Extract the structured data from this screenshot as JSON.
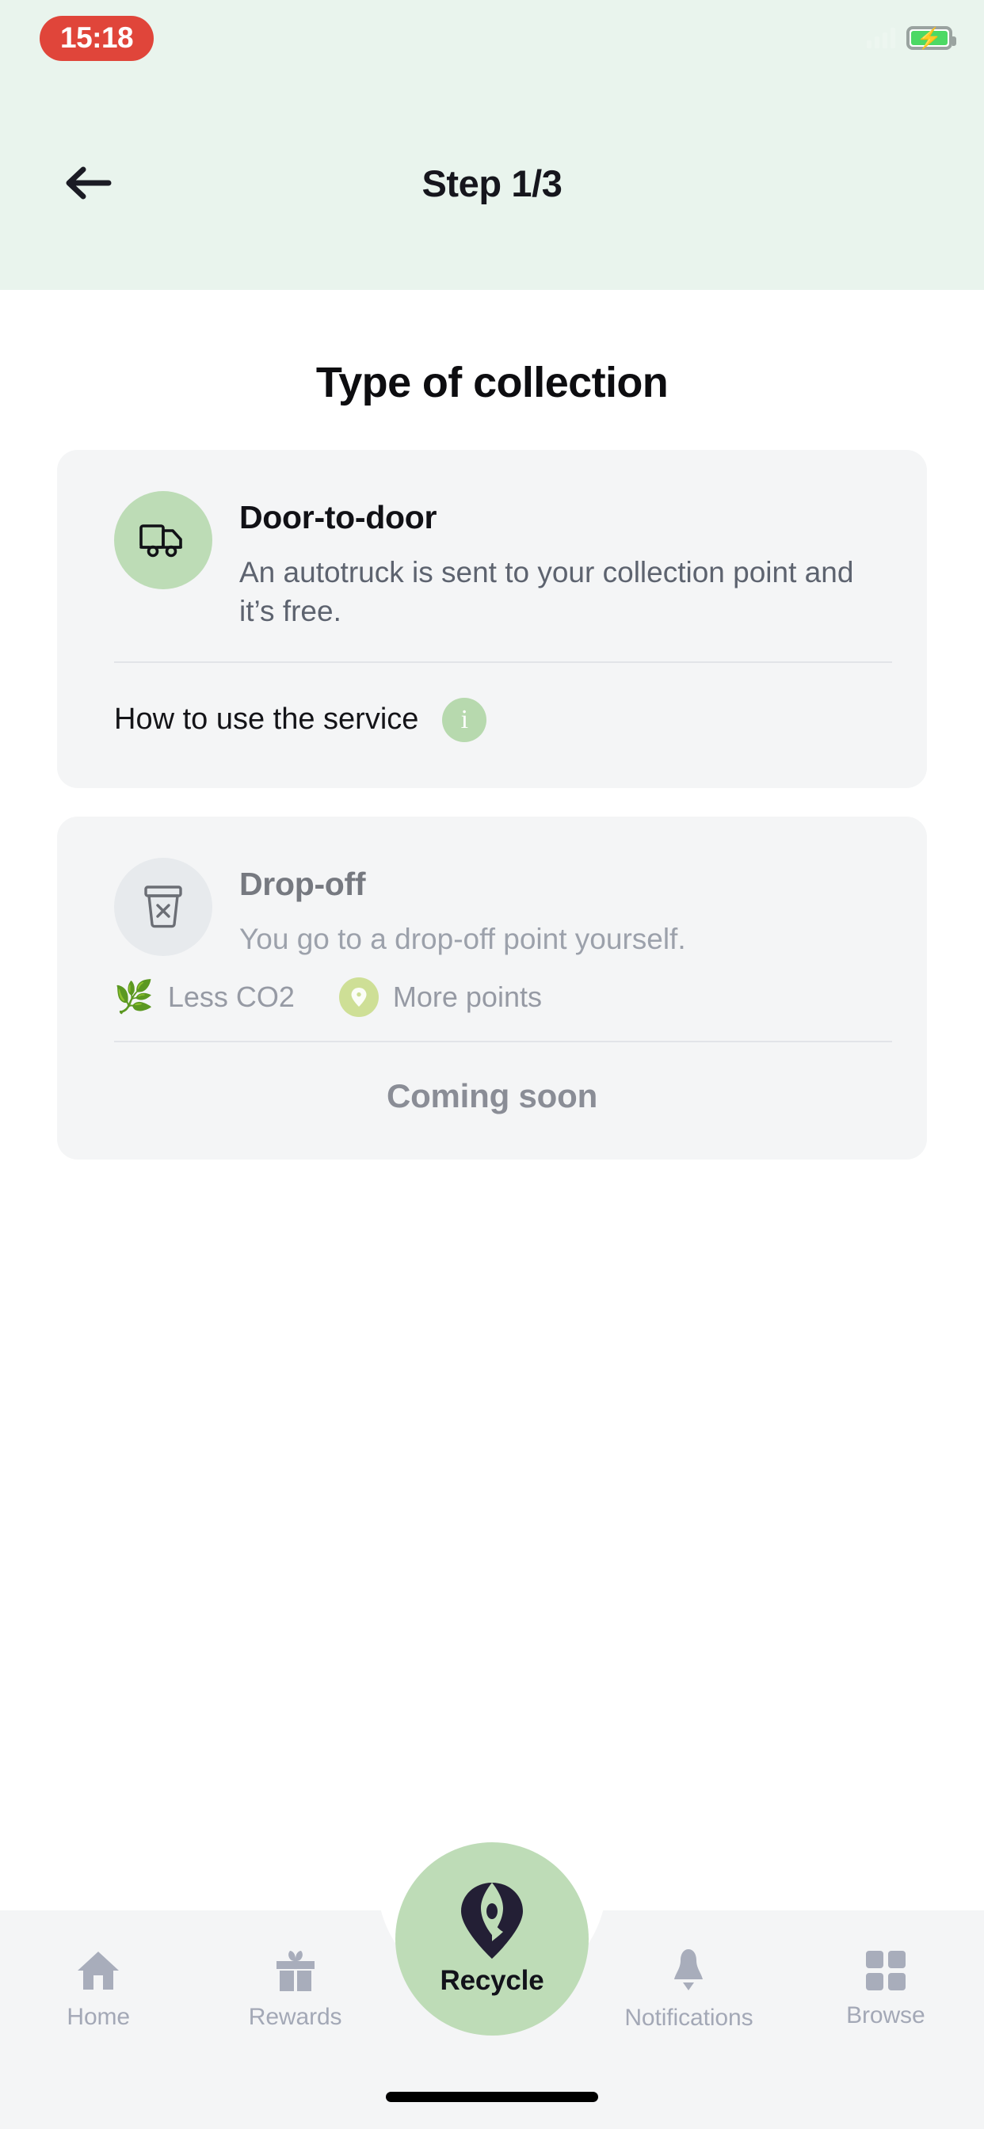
{
  "status_bar": {
    "recording_time": "15:18",
    "recording_pill_color": "#e0453a",
    "battery_icon": "battery-charging-icon",
    "battery_color": "#4cd964",
    "signal_icon": "signal-bars-icon"
  },
  "header": {
    "back_icon": "arrow-left-icon",
    "title": "Step 1/3",
    "background_color": "#e9f4ed"
  },
  "main": {
    "page_title": "Type of collection",
    "options": [
      {
        "id": "door-to-door",
        "icon": "truck-icon",
        "icon_bg_color": "#bddcb6",
        "title": "Door-to-door",
        "description": "An autotruck is sent to your collection point and it’s free.",
        "enabled": true,
        "footer_label": "How to use the service",
        "footer_icon": "info-icon",
        "footer_icon_bg_color": "#b7d9ae"
      },
      {
        "id": "drop-off",
        "icon": "bin-x-icon",
        "icon_bg_color": "#e7eaed",
        "title": "Drop-off",
        "description": "You go to a drop-off point yourself.",
        "enabled": false,
        "badges": [
          {
            "icon": "herb-leaf-icon",
            "label": "Less CO2"
          },
          {
            "icon": "points-pin-icon",
            "label": "More points",
            "icon_bg_color": "#cedf96"
          }
        ],
        "status_label": "Coming soon"
      }
    ]
  },
  "tabbar": {
    "background_color": "#f4f5f6",
    "inactive_color": "#a3a8b6",
    "items": [
      {
        "id": "home",
        "icon": "home-icon",
        "label": "Home"
      },
      {
        "id": "rewards",
        "icon": "gift-icon",
        "label": "Rewards"
      },
      {
        "id": "notifications",
        "icon": "bell-icon",
        "label": "Notifications"
      },
      {
        "id": "browse",
        "icon": "grid-squares-icon",
        "label": "Browse"
      }
    ],
    "fab": {
      "id": "recycle",
      "label": "Recycle",
      "icon": "recycle-pin-logo-icon",
      "bg_color": "#bedcb7",
      "icon_color": "#231f35"
    }
  }
}
